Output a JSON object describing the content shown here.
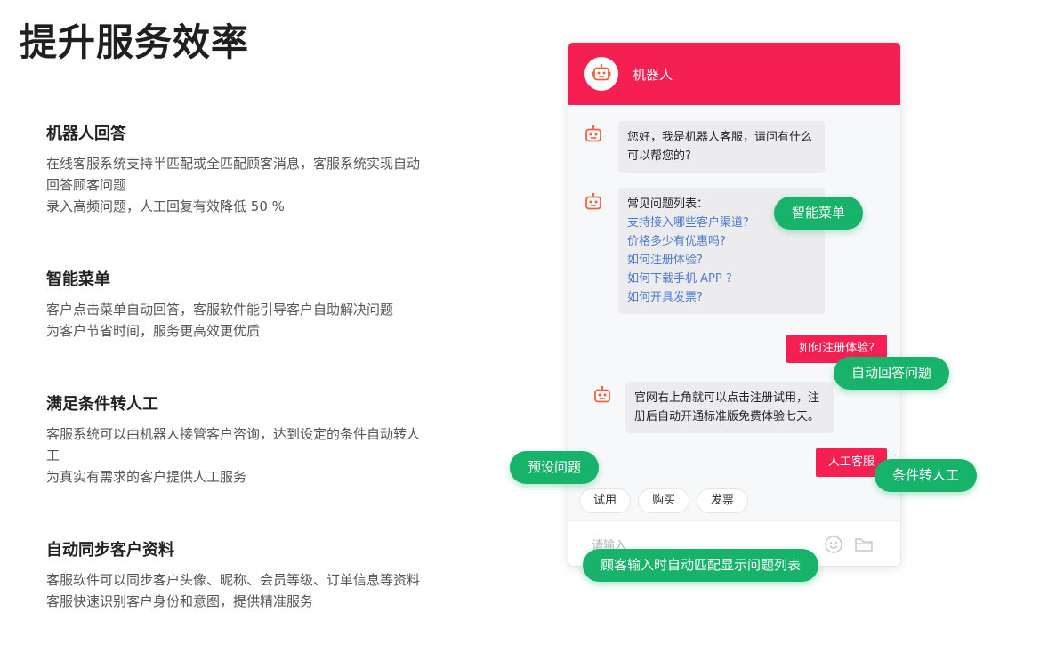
{
  "page": {
    "title": "提升服务效率"
  },
  "features": [
    {
      "title": "机器人回答",
      "lines": [
        "在线客服系统支持半匹配或全匹配顾客消息，客服系统实现自动回答顾客问题",
        "录入高频问题，人工回复有效降低 50 %"
      ]
    },
    {
      "title": "智能菜单",
      "lines": [
        "客户点击菜单自动回答，客服软件能引导客户自助解决问题",
        "为客户节省时间，服务更高效更优质"
      ]
    },
    {
      "title": "满足条件转人工",
      "lines": [
        "客服系统可以由机器人接管客户咨询，达到设定的条件自动转人工",
        "为真实有需求的客户提供人工服务"
      ]
    },
    {
      "title": "自动同步客户资料",
      "lines": [
        "客服软件可以同步客户头像、昵称、会员等级、订单信息等资料",
        "客服快速识别客户身份和意图，提供精准服务"
      ]
    }
  ],
  "chat": {
    "header_name": "机器人",
    "msg_greeting": [
      "您好，我是机器人客服，请问有什么",
      "可以帮您的?"
    ],
    "faq_title": "常见问题列表：",
    "faq_links": [
      "支持接入哪些客户渠道?",
      "价格多少有优惠吗?",
      "如何注册体验?",
      "如何下载手机 APP ?",
      "如何开具发票?"
    ],
    "user_msg_1": "如何注册体验?",
    "msg_answer": [
      "官网右上角就可以点击注册试用，注",
      "册后自动开通标准版免费体验七天。"
    ],
    "user_msg_2": "人工客服",
    "quick_buttons": [
      "试用",
      "购买",
      "发票"
    ],
    "input_placeholder": "请输入"
  },
  "callouts": {
    "smart_menu": "智能菜单",
    "auto_answer": "自动回答问题",
    "preset": "预设问题",
    "transfer": "条件转人工",
    "auto_match": "顾客输入时自动匹配显示问题列表"
  },
  "colors": {
    "brand_red": "#f51f52",
    "callout_green": "#18b36b",
    "link_blue": "#4a7bd0"
  },
  "icons": {
    "robot": "robot-icon",
    "emoji": "smile-icon",
    "folder": "folder-icon"
  }
}
